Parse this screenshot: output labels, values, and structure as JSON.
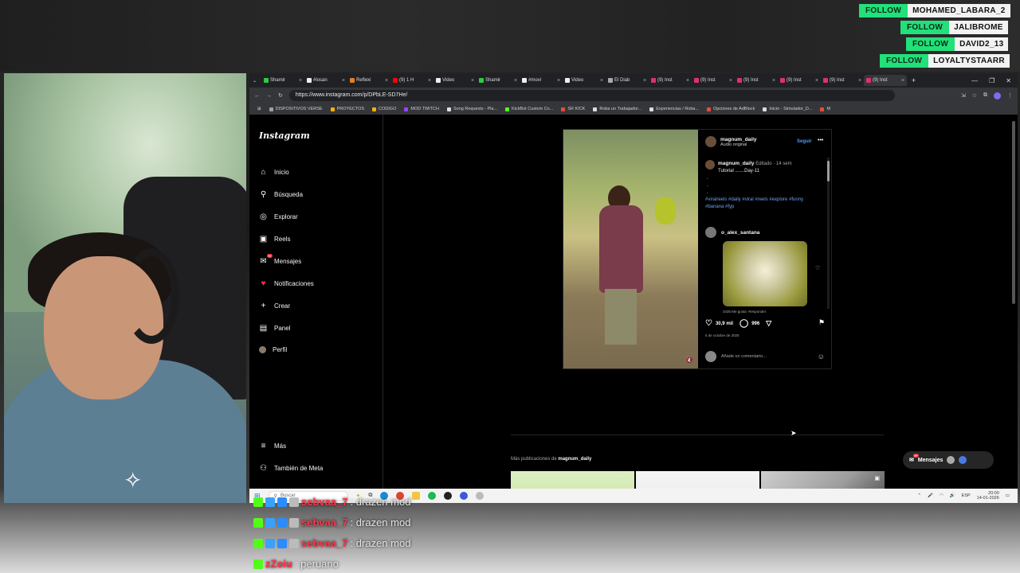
{
  "follows": [
    {
      "label": "FOLLOW",
      "name": "MOHAMED_LABARA_2"
    },
    {
      "label": "FOLLOW",
      "name": "JALIBROME"
    },
    {
      "label": "FOLLOW",
      "name": "DAVID2_13"
    },
    {
      "label": "FOLLOW",
      "name": "LOYALTYSTAARR"
    }
  ],
  "browser": {
    "tabs": [
      "Shamir",
      "#losan",
      "Reflexi",
      "(9) 1 H",
      "Video",
      "Shamir",
      "#movi",
      "Video",
      "El Diab",
      "(9) Inst",
      "(9) Inst",
      "(9) Inst",
      "(9) Inst",
      "(9) Inst",
      "(9) Inst"
    ],
    "new_tab": "+",
    "url": "https://www.instagram.com/p/DPbLE-SD7He/",
    "bookmarks": [
      "DISPOSITIVOS VERSE",
      "PROYECTOS",
      "CODIGO",
      "MOD TWITCH",
      "Song Requests - Pla...",
      "KickBot Custom Co...",
      "SR KICK",
      "Roba un Trabajador...",
      "Experiencias / Roba...",
      "Opciones de AdBlock",
      "Inicio - Simulador_D...",
      "M"
    ]
  },
  "instagram": {
    "logo": "Instagram",
    "nav": [
      {
        "label": "Inicio",
        "icon": "home-icon",
        "glyph": "⌂"
      },
      {
        "label": "Búsqueda",
        "icon": "search-icon",
        "glyph": "⚲"
      },
      {
        "label": "Explorar",
        "icon": "compass-icon",
        "glyph": "◎"
      },
      {
        "label": "Reels",
        "icon": "reels-icon",
        "glyph": "▣"
      },
      {
        "label": "Mensajes",
        "icon": "messenger-icon",
        "glyph": "✉",
        "badge": "9+"
      },
      {
        "label": "Notificaciones",
        "icon": "heart-icon",
        "glyph": "♡"
      },
      {
        "label": "Crear",
        "icon": "plus-icon",
        "glyph": "+"
      },
      {
        "label": "Panel",
        "icon": "dashboard-icon",
        "glyph": "▤"
      },
      {
        "label": "Perfil",
        "icon": "profile-avatar",
        "glyph": "●"
      }
    ],
    "bottom_nav": [
      {
        "label": "Más",
        "icon": "menu-icon",
        "glyph": "≡"
      },
      {
        "label": "También de Meta",
        "icon": "meta-icon",
        "glyph": "⚇"
      }
    ],
    "post": {
      "author": "magnum_daily",
      "audio": "Audio original",
      "follow": "Seguir",
      "caption_user": "magnum_daily",
      "edited": "Editado",
      "age": "14 sem",
      "caption": "Tutorial .......Day-11",
      "dots": [
        ".",
        ".",
        "."
      ],
      "hashtags": "#viralreels #daily #viral #reels #explore #funny #banana #fyp",
      "comment_user": "o_alex_santana",
      "comment_likes": "3435 Me gusta",
      "reply": "Responder",
      "likes": "30,9 mil",
      "comments": "996",
      "date": "5 de octubre de 2025",
      "add_comment": "Añade un comentario..."
    },
    "more_posts_prefix": "Más publicaciones de ",
    "more_posts_user": "magnum_daily",
    "messages_pill": "Mensajes",
    "messages_badge": "9+"
  },
  "taskbar": {
    "search": "Buscar",
    "lang": "ESP",
    "time": "20:00",
    "date": "14-01-2026"
  },
  "chat": [
    {
      "user": "sebvaa_7",
      "msg": ": drazen mod"
    },
    {
      "user": "sebvaa_7",
      "msg": ": drazen mod"
    },
    {
      "user": "sebvaa_7",
      "msg": ": drazen mod"
    },
    {
      "user": "zZoiu",
      "msg": ": peruano"
    }
  ],
  "colors": {
    "follow_green": "#22e07a",
    "ig_link_blue": "#4c9bf5",
    "hashtag_blue": "#6aa3f0",
    "chat_red": "#ff3548"
  }
}
